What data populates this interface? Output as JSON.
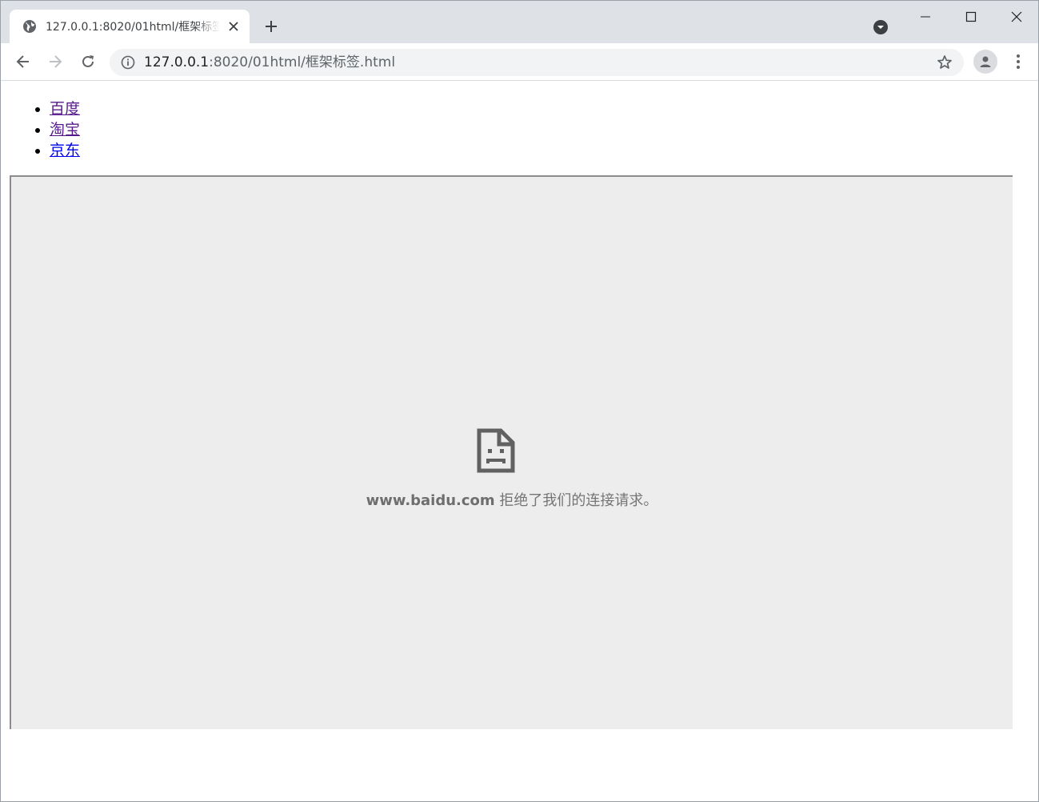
{
  "browser": {
    "tab": {
      "title": "127.0.0.1:8020/01html/框架标签.html",
      "favicon": "globe-icon",
      "close": "close-icon"
    },
    "new_tab": "plus-icon",
    "tab_search": "tab-search-icon",
    "window_controls": [
      "minimize-icon",
      "maximize-icon",
      "close-icon"
    ],
    "toolbar": {
      "back": "arrow-left-icon",
      "forward": "arrow-right-icon",
      "reload": "reload-icon",
      "address": {
        "host": "127.0.0.1",
        "path": ":8020/01html/框架标签.html",
        "info_icon": "info-icon",
        "bookmark_icon": "star-icon"
      },
      "profile": "person-icon",
      "menu": "kebab-menu-icon"
    }
  },
  "page": {
    "links": [
      {
        "label": "百度",
        "state": "visited"
      },
      {
        "label": "淘宝",
        "state": "visited"
      },
      {
        "label": "京东",
        "state": "link"
      }
    ],
    "iframe": {
      "error_icon": "sad-document-icon",
      "error_host": "www.baidu.com",
      "error_text": " 拒绝了我们的连接请求。"
    }
  },
  "colors": {
    "tabstrip": "#dee1e6",
    "omnibox": "#f1f3f4",
    "iframe_bg": "#ededed",
    "visited_link": "#551a8b",
    "link": "#0000ee"
  }
}
